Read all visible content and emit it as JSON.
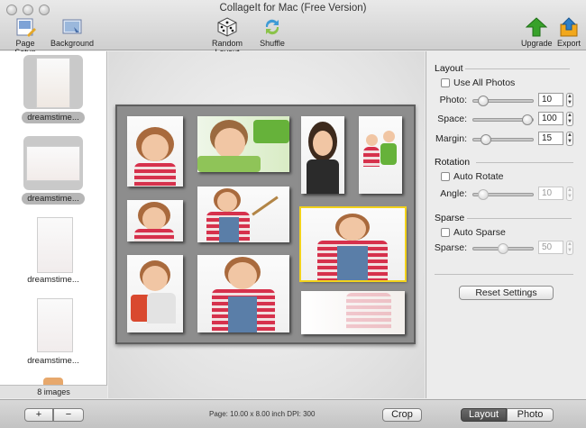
{
  "window": {
    "title": "CollageIt for Mac (Free Version)"
  },
  "toolbar": {
    "page_setup": "Page Setup",
    "background": "Background",
    "random_layout": "Random Layout",
    "shuffle": "Shuffle",
    "upgrade": "Upgrade",
    "export": "Export"
  },
  "sidebar": {
    "items": [
      {
        "label": "dreamstime..."
      },
      {
        "label": "dreamstime..."
      },
      {
        "label": "dreamstime..."
      },
      {
        "label": "dreamstime..."
      }
    ],
    "count": "8 images"
  },
  "layout": {
    "heading": "Layout",
    "use_all": "Use All Photos",
    "photo_label": "Photo:",
    "photo_value": "10",
    "photo_level": 0.1,
    "space_label": "Space:",
    "space_value": "100",
    "space_level": 1.0,
    "margin_label": "Margin:",
    "margin_value": "15",
    "margin_level": 0.15
  },
  "rotation": {
    "heading": "Rotation",
    "auto": "Auto Rotate",
    "angle_label": "Angle:",
    "angle_value": "10",
    "angle_level": 0.1
  },
  "sparse": {
    "heading": "Sparse",
    "auto": "Auto Sparse",
    "sparse_label": "Sparse:",
    "sparse_value": "50",
    "sparse_level": 0.5
  },
  "reset": "Reset Settings",
  "bottom": {
    "add": "+",
    "remove": "−",
    "page_info": "Page: 10.00 x 8.00 inch DPI: 300",
    "crop": "Crop",
    "tab_layout": "Layout",
    "tab_photo": "Photo"
  },
  "colors": {
    "accent_yellow": "#f2d21b",
    "upgrade_green": "#38a12a",
    "export_orange": "#f2a81c"
  }
}
